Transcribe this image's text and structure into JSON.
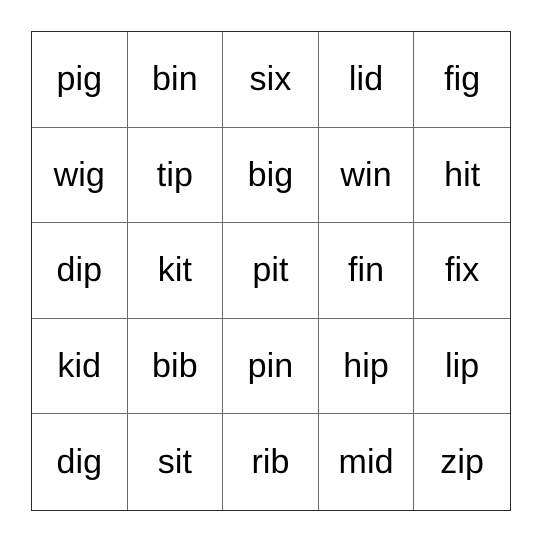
{
  "card": {
    "type": "bingo-card",
    "columns": 5,
    "rows": 5,
    "background_color": "#ffffff",
    "outer_border_color": "#2b2b2b",
    "grid_line_color": "#6b6b6b",
    "text_color": "#000000",
    "cells": [
      [
        "pig",
        "bin",
        "six",
        "lid",
        "fig"
      ],
      [
        "wig",
        "tip",
        "big",
        "win",
        "hit"
      ],
      [
        "dip",
        "kit",
        "pit",
        "fin",
        "fix"
      ],
      [
        "kid",
        "bib",
        "pin",
        "hip",
        "lip"
      ],
      [
        "dig",
        "sit",
        "rib",
        "mid",
        "zip"
      ]
    ]
  }
}
